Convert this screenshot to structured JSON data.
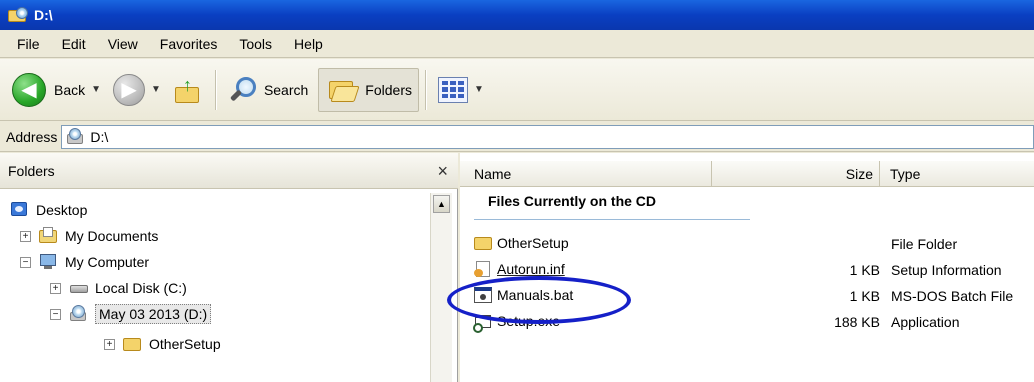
{
  "window": {
    "title": "D:\\"
  },
  "menubar": {
    "items": [
      "File",
      "Edit",
      "View",
      "Favorites",
      "Tools",
      "Help"
    ]
  },
  "toolbar": {
    "back_label": "Back",
    "search_label": "Search",
    "folders_label": "Folders"
  },
  "address": {
    "label": "Address",
    "value": "D:\\"
  },
  "folders_pane": {
    "title": "Folders",
    "close_glyph": "×",
    "tree": [
      {
        "label": "Desktop",
        "icon": "desktop-icon",
        "expander": ""
      },
      {
        "label": "My Documents",
        "icon": "my-documents-icon",
        "expander": "+"
      },
      {
        "label": "My Computer",
        "icon": "my-computer-icon",
        "expander": "−"
      },
      {
        "label": "Local Disk (C:)",
        "icon": "hard-drive-icon",
        "expander": "+"
      },
      {
        "label": "May 03 2013 (D:)",
        "icon": "cd-drive-icon",
        "expander": "−",
        "selected": true
      },
      {
        "label": "OtherSetup",
        "icon": "folder-icon",
        "expander": "+"
      }
    ]
  },
  "file_list": {
    "columns": {
      "name": "Name",
      "size": "Size",
      "type": "Type"
    },
    "group_title": "Files Currently on the CD",
    "rows": [
      {
        "name": "OtherSetup",
        "size": "",
        "type": "File Folder",
        "icon": "folder-icon"
      },
      {
        "name": "Autorun.inf",
        "size": "1 KB",
        "type": "Setup Information",
        "icon": "setup-info-icon"
      },
      {
        "name": "Manuals.bat",
        "size": "1 KB",
        "type": "MS-DOS Batch File",
        "icon": "batch-file-icon"
      },
      {
        "name": "Setup.exe",
        "size": "188 KB",
        "type": "Application",
        "icon": "application-icon"
      }
    ]
  },
  "colors": {
    "titlebar": "#0a3fc2",
    "annotation": "#1520c8",
    "chrome": "#ece9d8"
  }
}
